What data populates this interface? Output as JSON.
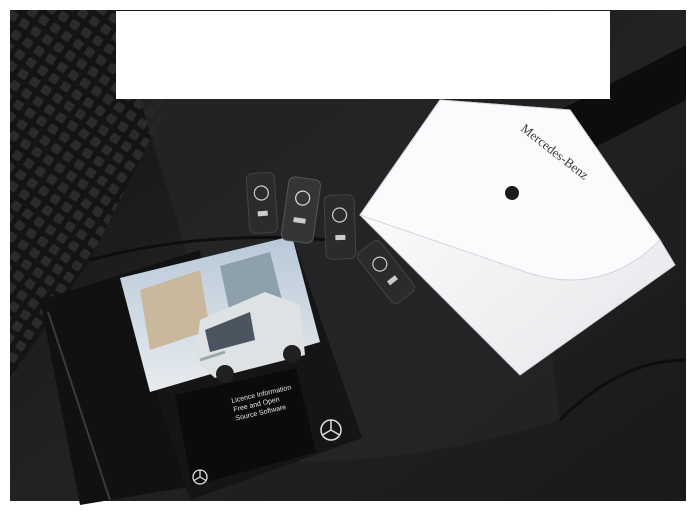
{
  "scene": {
    "brand_text": "Mercedes-Benz",
    "booklet_title_lines": [
      "Licence Information",
      "Free and Open",
      "Source Software"
    ],
    "colors": {
      "seat": "#1f1f21",
      "pouch": "#f2f3f4",
      "van": "#d9dcdf",
      "booklet_dark": "#141414",
      "key_fob": "#2a2b2d"
    },
    "redaction_color": "#ffffff"
  }
}
